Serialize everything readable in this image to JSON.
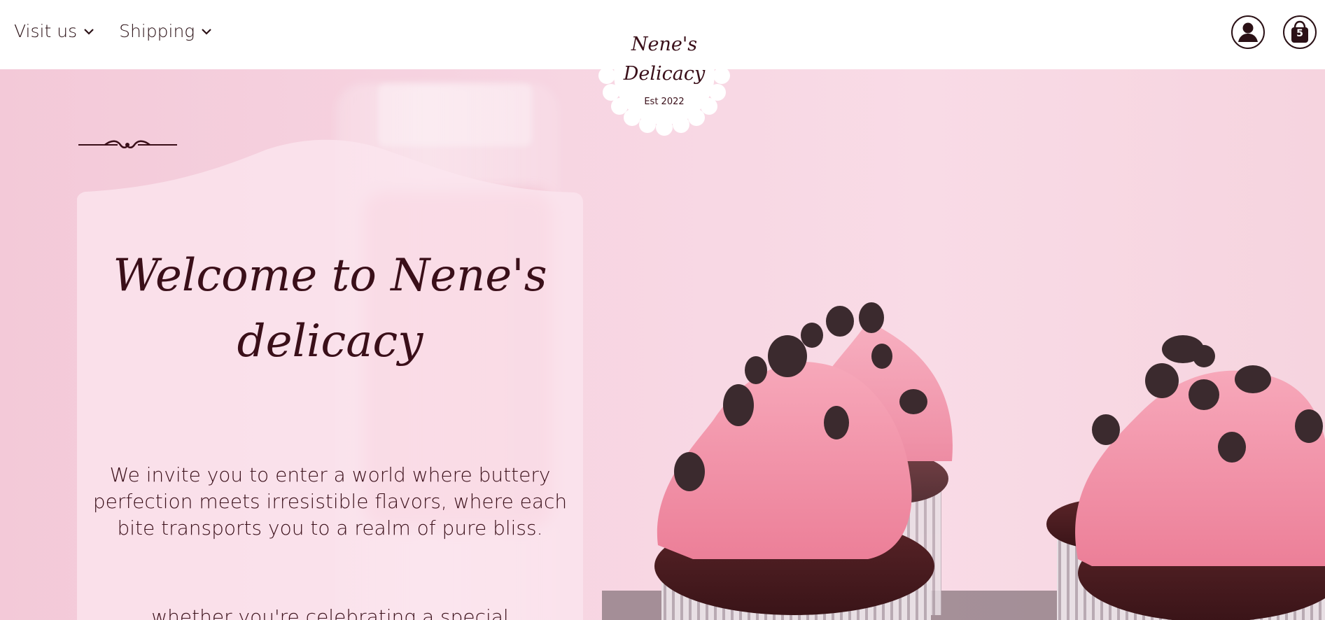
{
  "header": {
    "nav": [
      {
        "label": "Visit us"
      },
      {
        "label": "Shipping"
      }
    ],
    "cart_count": "5"
  },
  "logo": {
    "line1": "Nene's",
    "line2": "Delicacy",
    "est": "Est 2022"
  },
  "hero": {
    "title_line1": "Welcome to Nene's",
    "title_line2": "delicacy",
    "body": "We invite you to enter a world where buttery perfection meets irresistible flavors, where each bite transports you to a realm of pure bliss.",
    "body2": "whether you're celebrating a special"
  },
  "colors": {
    "brand_text": "#3a0f19",
    "hero_bg": "#f6d3df",
    "frosting": "#f08ca4",
    "chocolate": "#3b2a2e"
  }
}
